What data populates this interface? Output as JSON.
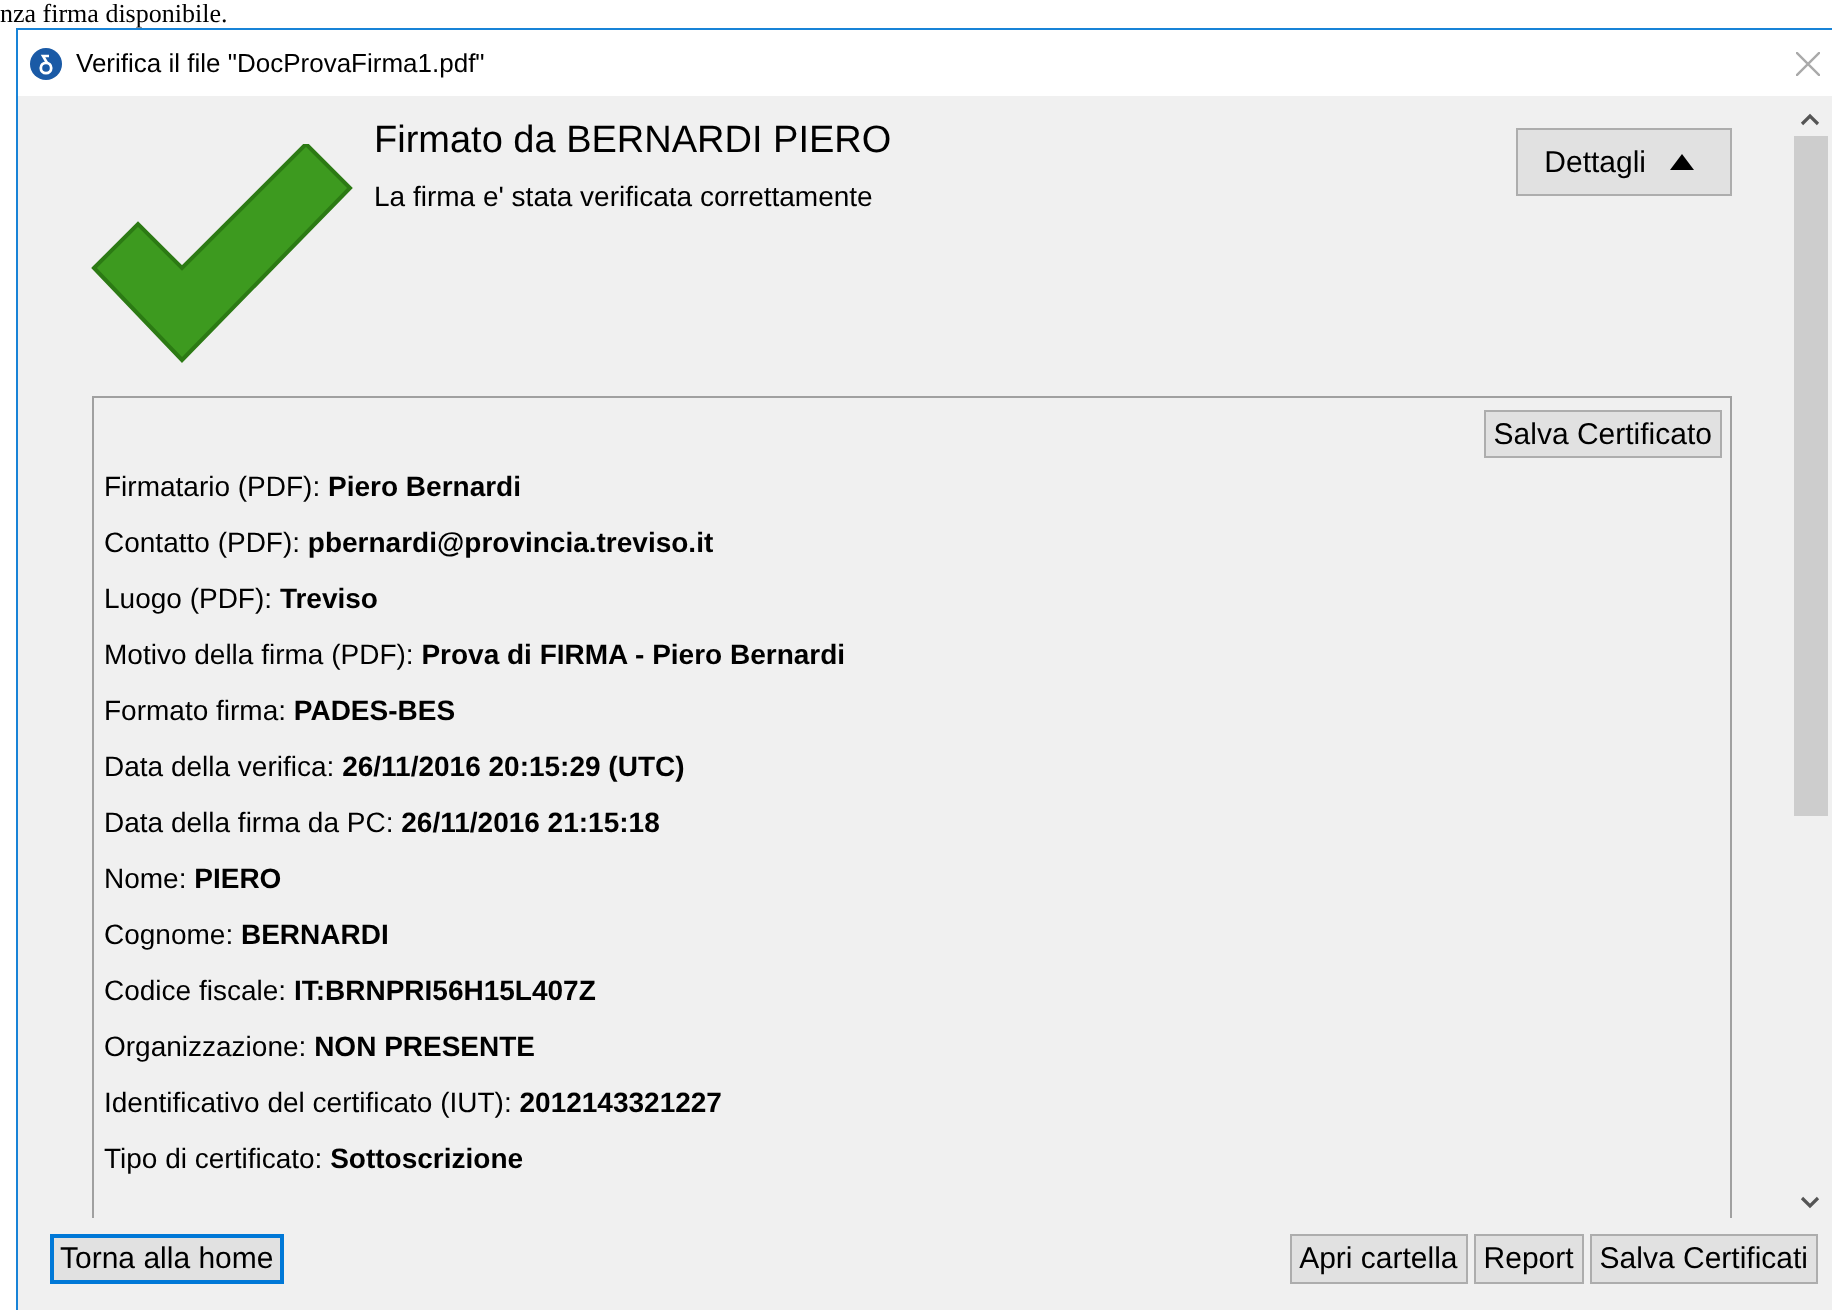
{
  "background_text": "nza firma disponibile.",
  "window": {
    "title": "Verifica il file \"DocProvaFirma1.pdf\""
  },
  "result": {
    "title": "Firmato da BERNARDI PIERO",
    "message": "La firma e' stata verificata correttamente",
    "details_button": {
      "label": "Dettagli",
      "expanded": true
    }
  },
  "details": {
    "save_button": "Salva Certificato",
    "fields": [
      {
        "label": "Firmatario (PDF):",
        "value": "Piero Bernardi"
      },
      {
        "label": "Contatto (PDF):",
        "value": "pbernardi@provincia.treviso.it"
      },
      {
        "label": "Luogo (PDF):",
        "value": "Treviso"
      },
      {
        "label": "Motivo della firma (PDF):",
        "value": "Prova di FIRMA - Piero Bernardi"
      },
      {
        "label": "Formato firma:",
        "value": "PADES-BES"
      },
      {
        "label": "Data della verifica:",
        "value": "26/11/2016 20:15:29 (UTC)"
      },
      {
        "label": "Data della firma da PC:",
        "value": "26/11/2016 21:15:18"
      },
      {
        "label": "Nome:",
        "value": "PIERO"
      },
      {
        "label": "Cognome:",
        "value": "BERNARDI"
      },
      {
        "label": "Codice fiscale:",
        "value": "IT:BRNPRI56H15L407Z"
      },
      {
        "label": "Organizzazione:",
        "value": "NON PRESENTE"
      },
      {
        "label": "Identificativo del certificato (IUT):",
        "value": "2012143321227"
      },
      {
        "label": "Tipo di certificato:",
        "value": "Sottoscrizione"
      }
    ]
  },
  "footer": {
    "left_button": {
      "label": "Torna alla home",
      "focused": true
    },
    "right_buttons": [
      "Apri cartella",
      "Report",
      "Salva Certificati"
    ]
  }
}
